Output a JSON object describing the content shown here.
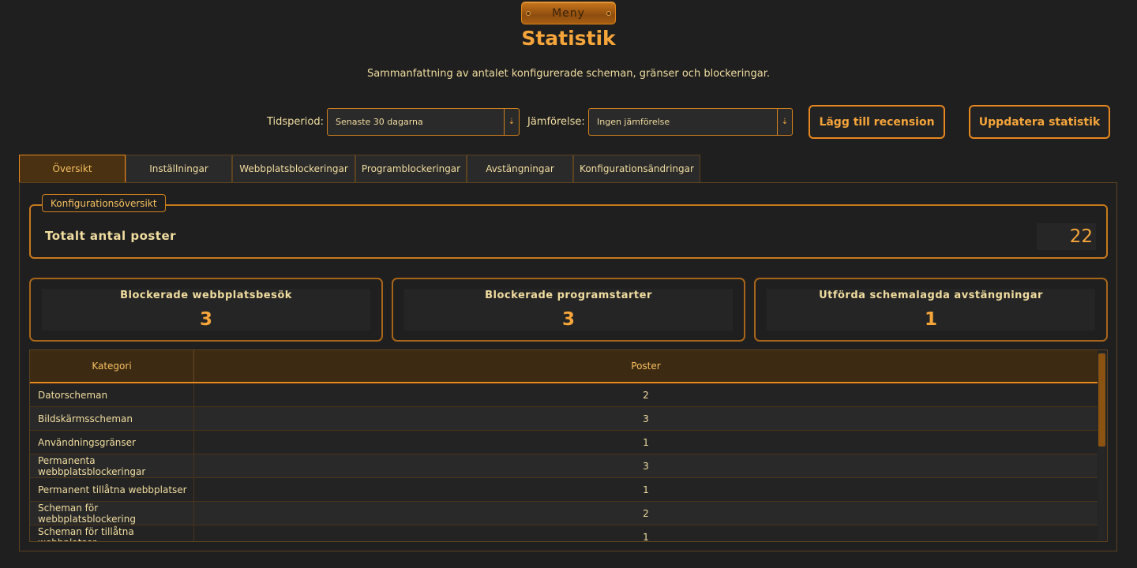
{
  "header": {
    "menu_label": "Meny",
    "title": "Statistik",
    "subtitle": "Sammanfattning av antalet konfigurerade scheman, gränser och blockeringar."
  },
  "controls": {
    "period_label": "Tidsperiod:",
    "period_value": "Senaste 30 dagarna",
    "compare_label": "Jämförelse:",
    "compare_value": "Ingen jämförelse",
    "add_review_label": "Lägg till recension",
    "refresh_label": "Uppdatera statistik"
  },
  "tabs": [
    {
      "label": "Översikt",
      "active": true
    },
    {
      "label": "Inställningar",
      "active": false
    },
    {
      "label": "Webbplatsblockeringar",
      "active": false
    },
    {
      "label": "Programblockeringar",
      "active": false
    },
    {
      "label": "Avstängningar",
      "active": false
    },
    {
      "label": "Konfigurationsändringar",
      "active": false
    }
  ],
  "overview": {
    "group_title": "Konfigurationsöversikt",
    "total_label": "Totalt antal poster",
    "total_value": "22"
  },
  "cards": [
    {
      "title": "Blockerade webbplatsbesök",
      "value": "3"
    },
    {
      "title": "Blockerade programstarter",
      "value": "3"
    },
    {
      "title": "Utförda schemalagda avstängningar",
      "value": "1"
    }
  ],
  "table": {
    "headers": [
      "Kategori",
      "Poster"
    ],
    "rows": [
      [
        "Datorscheman",
        "2"
      ],
      [
        "Bildskärmsscheman",
        "3"
      ],
      [
        "Användningsgränser",
        "1"
      ],
      [
        "Permanenta webbplatsblockeringar",
        "3"
      ],
      [
        "Permanent tillåtna webbplatser",
        "1"
      ],
      [
        "Scheman för webbplatsblockering",
        "2"
      ],
      [
        "Scheman för tillåtna webbplatser",
        "1"
      ]
    ]
  },
  "colors": {
    "accent": "#f6a53a",
    "border": "#e8871e",
    "background": "#1f1f1f",
    "text": "#f1dda0"
  }
}
